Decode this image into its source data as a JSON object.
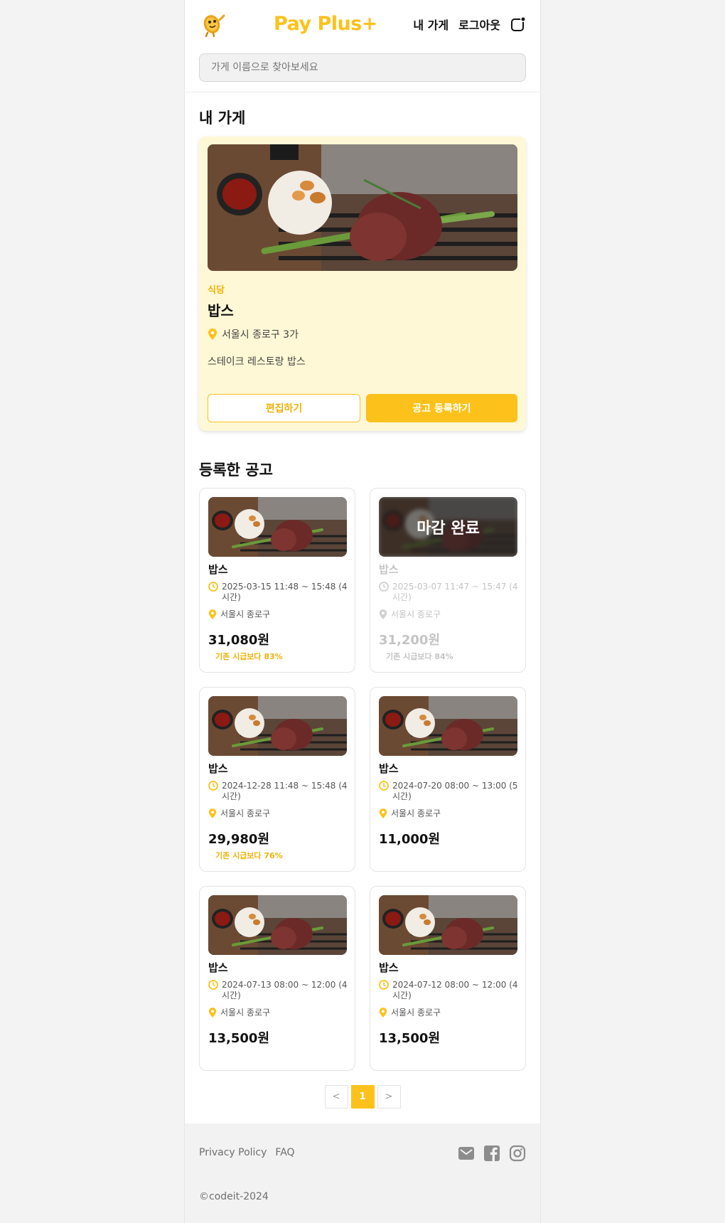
{
  "header": {
    "brand": "Pay Plus+",
    "nav_my_store": "내 가게",
    "nav_logout": "로그아웃",
    "search_placeholder": "가게 이름으로 찾아보세요"
  },
  "my_store": {
    "section_title": "내 가게",
    "category": "식당",
    "name": "밥스",
    "address": "서울시 종로구 3가",
    "description": "스테이크 레스토랑 밥스",
    "edit_label": "편집하기",
    "post_label": "공고 등록하기"
  },
  "posts_section": {
    "title": "등록한 공고",
    "items": [
      {
        "name": "밥스",
        "time": "2025-03-15 11:48 ~ 15:48 (4시간)",
        "address": "서울시 종로구",
        "price": "31,080원",
        "rate": "기존 시급보다 83%",
        "closed": false
      },
      {
        "name": "밥스",
        "time": "2025-03-07 11:47 ~ 15:47 (4시간)",
        "address": "서울시 종로구",
        "price": "31,200원",
        "rate": "기존 시급보다 84%",
        "closed": true,
        "closed_label": "마감 완료"
      },
      {
        "name": "밥스",
        "time": "2024-12-28 11:48 ~ 15:48 (4시간)",
        "address": "서울시 종로구",
        "price": "29,980원",
        "rate": "기존 시급보다 76%",
        "closed": false
      },
      {
        "name": "밥스",
        "time": "2024-07-20 08:00 ~ 13:00 (5시간)",
        "address": "서울시 종로구",
        "price": "11,000원",
        "rate": "",
        "closed": false
      },
      {
        "name": "밥스",
        "time": "2024-07-13 08:00 ~ 12:00 (4시간)",
        "address": "서울시 종로구",
        "price": "13,500원",
        "rate": "",
        "closed": false
      },
      {
        "name": "밥스",
        "time": "2024-07-12 08:00 ~ 12:00 (4시간)",
        "address": "서울시 종로구",
        "price": "13,500원",
        "rate": "",
        "closed": false
      }
    ]
  },
  "pagination": {
    "prev": "<",
    "current": "1",
    "next": ">"
  },
  "footer": {
    "privacy": "Privacy Policy",
    "faq": "FAQ",
    "copyright": "©codeit-2024",
    "icons": [
      "mail-icon",
      "facebook-icon",
      "instagram-icon"
    ]
  },
  "colors": {
    "accent": "#fcc21b",
    "store_bg": "#fff8d6"
  }
}
